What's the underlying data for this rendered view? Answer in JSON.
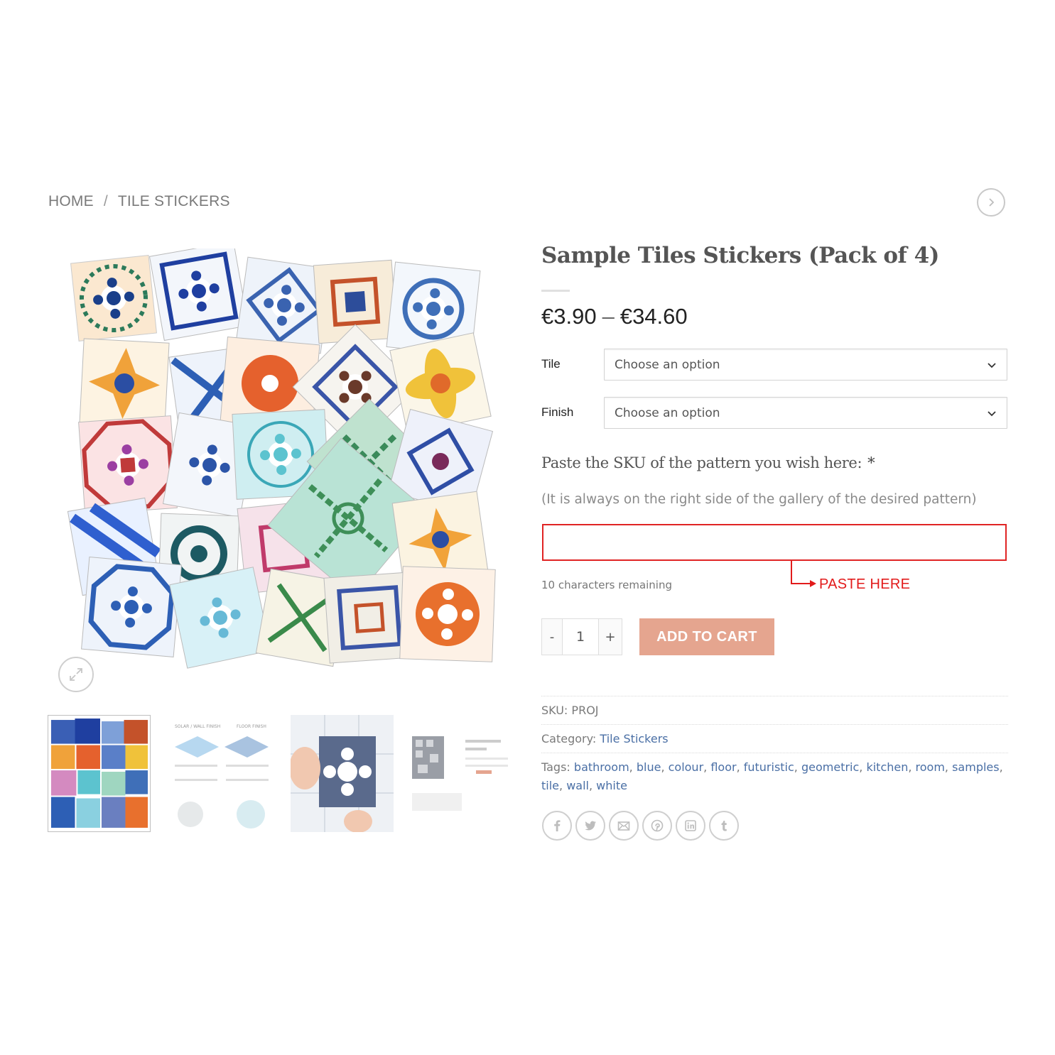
{
  "breadcrumb": {
    "home": "HOME",
    "separator": "/",
    "category": "TILE STICKERS"
  },
  "product": {
    "title": "Sample Tiles Stickers (Pack of 4)",
    "price_min": "€3.90",
    "price_sep": "–",
    "price_max": "€34.60"
  },
  "variations": {
    "tile_label": "Tile",
    "tile_value": "Choose an option",
    "finish_label": "Finish",
    "finish_value": "Choose an option"
  },
  "sku_field": {
    "label": "Paste the SKU of the pattern you wish here:",
    "required_mark": "*",
    "help": "(It is always on the right side of the gallery of the desired pattern)",
    "value": "",
    "chars_remaining": "10 characters remaining",
    "annotation": "PASTE HERE",
    "annotation_color": "#e21b1b"
  },
  "cart": {
    "minus": "-",
    "quantity": "1",
    "plus": "+",
    "add_label": "ADD TO CART",
    "button_color": "#e5a58f"
  },
  "meta": {
    "sku_label": "SKU:",
    "sku_value": "PROJ",
    "category_label": "Category:",
    "category_value": "Tile Stickers",
    "tags_label": "Tags:",
    "tags": [
      "bathroom",
      "blue",
      "colour",
      "floor",
      "futuristic",
      "geometric",
      "kitchen",
      "room",
      "samples",
      "tile",
      "wall",
      "white"
    ]
  },
  "thumbnails": {
    "thumb2_label1": "SOLAR / WALL FINISH",
    "thumb2_label2": "FLOOR FINISH"
  },
  "share_icons": [
    "facebook-icon",
    "twitter-icon",
    "email-icon",
    "pinterest-icon",
    "linkedin-icon",
    "tumblr-icon"
  ]
}
